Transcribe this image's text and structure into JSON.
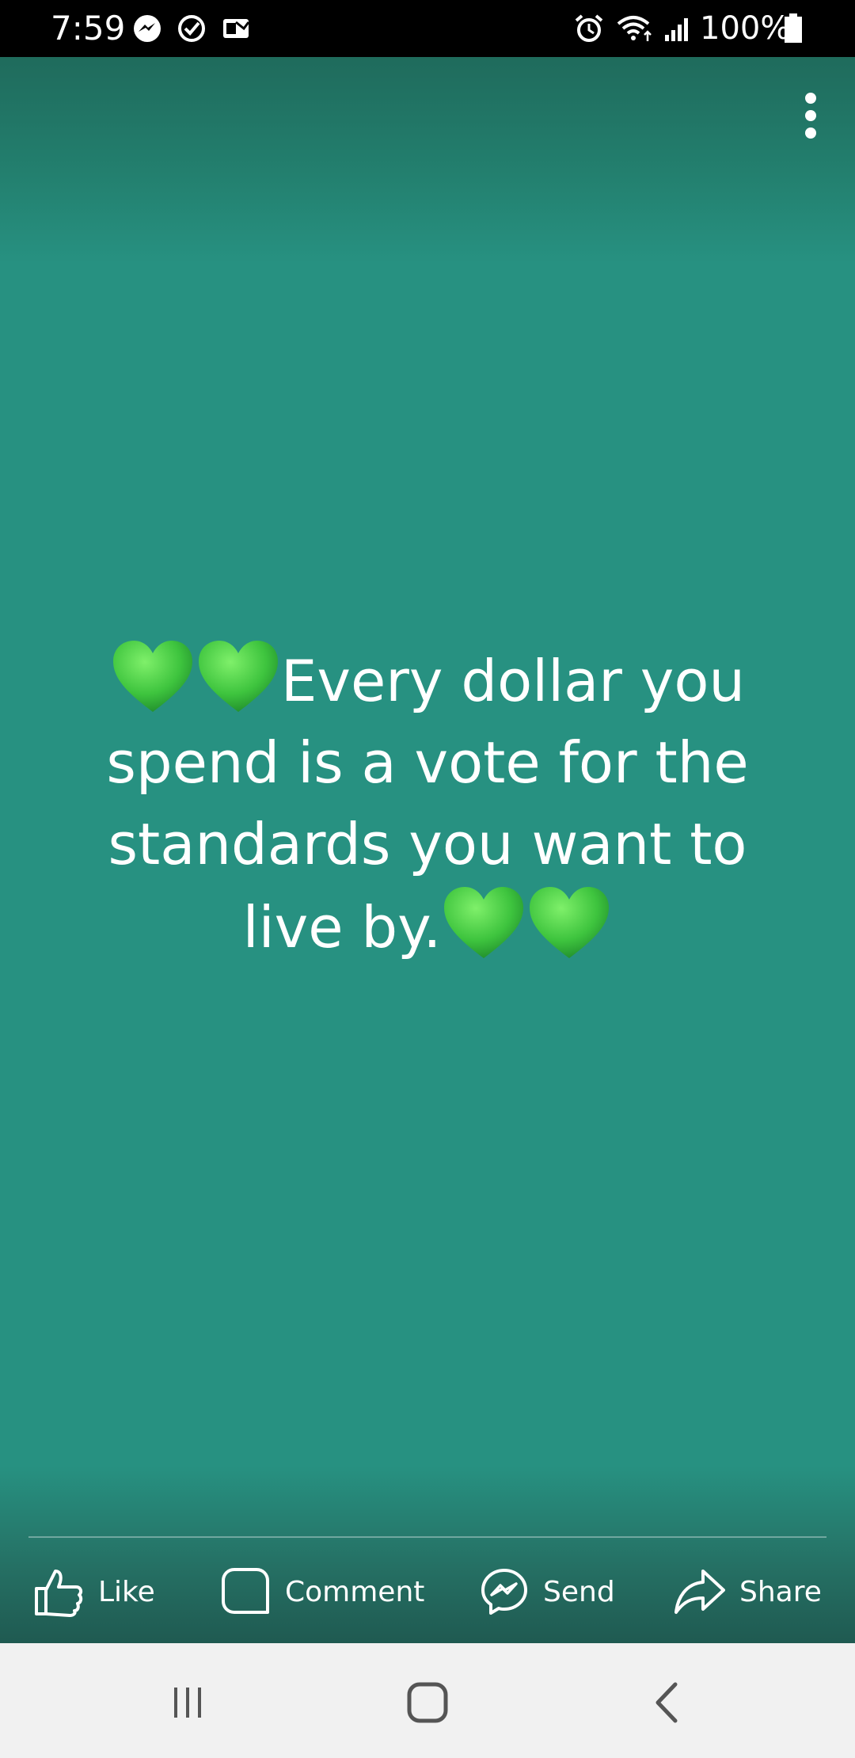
{
  "status_bar": {
    "time": "7:59",
    "battery": "100%",
    "left_icons": [
      "messenger-icon",
      "check-circle-icon",
      "email-icon"
    ],
    "right_icons": [
      "alarm-icon",
      "wifi-icon",
      "signal-icon",
      "battery-icon"
    ]
  },
  "post": {
    "background_color": "#279181",
    "text_color": "#ffffff",
    "heart_color": "#3ec43e",
    "quote": {
      "line1": "Every dollar you",
      "line2": "spend is a vote for the",
      "line3": "standards you want to",
      "line4": "live by."
    }
  },
  "actions": {
    "like": "Like",
    "comment": "Comment",
    "send": "Send",
    "share": "Share"
  },
  "nav_bar": {
    "buttons": [
      "recent-apps-icon",
      "home-icon",
      "back-icon"
    ]
  }
}
